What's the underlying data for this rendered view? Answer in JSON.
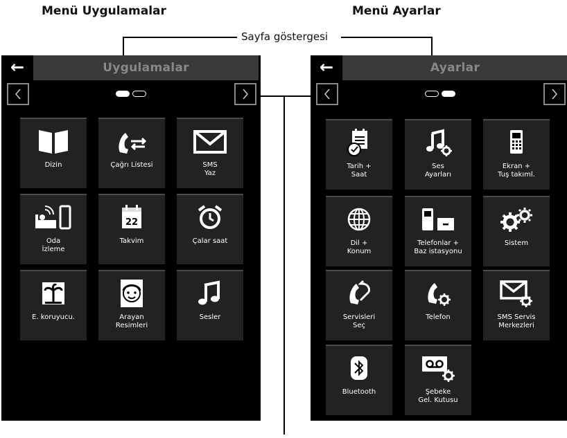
{
  "captions": {
    "left": "Menü Uygulamalar",
    "right": "Menü Ayarlar",
    "indicator": "Sayfa göstergesi"
  },
  "apps": {
    "title": "Uygulamalar",
    "tiles": [
      {
        "label": "Dizin",
        "icon": "book-icon"
      },
      {
        "label": "Çağrı Listesi",
        "icon": "call-list-icon"
      },
      {
        "label": "SMS\nYaz",
        "icon": "envelope-icon"
      },
      {
        "label": "Oda\nİzleme",
        "icon": "baby-monitor-icon"
      },
      {
        "label": "Takvim",
        "icon": "calendar-icon",
        "icon_text": "22"
      },
      {
        "label": "Çalar saat",
        "icon": "alarm-clock-icon"
      },
      {
        "label": "E. koruyucu.",
        "icon": "palm-tree-icon"
      },
      {
        "label": "Arayan\nResimleri",
        "icon": "face-icon"
      },
      {
        "label": "Sesler",
        "icon": "music-note-icon"
      }
    ]
  },
  "settings": {
    "title": "Ayarlar",
    "tiles": [
      {
        "label": "Tarih +\nSaat",
        "icon": "date-time-icon"
      },
      {
        "label": "Ses\nAyarları",
        "icon": "sound-settings-icon"
      },
      {
        "label": "Ekran +\nTuş takıml.",
        "icon": "display-keypad-icon"
      },
      {
        "label": "Dil +\nKonum",
        "icon": "globe-icon"
      },
      {
        "label": "Telefonlar +\nBaz istasyonu",
        "icon": "handsets-base-icon"
      },
      {
        "label": "Sistem",
        "icon": "gears-icon"
      },
      {
        "label": "Servisleri\nSeç",
        "icon": "select-services-icon"
      },
      {
        "label": "Telefon",
        "icon": "phone-settings-icon"
      },
      {
        "label": "SMS Servis\nMerkezleri",
        "icon": "sms-centres-icon"
      },
      {
        "label": "Bluetooth",
        "icon": "bluetooth-icon"
      },
      {
        "label": "Şebeke\nGel. Kutusu",
        "icon": "voicemail-icon"
      }
    ]
  }
}
